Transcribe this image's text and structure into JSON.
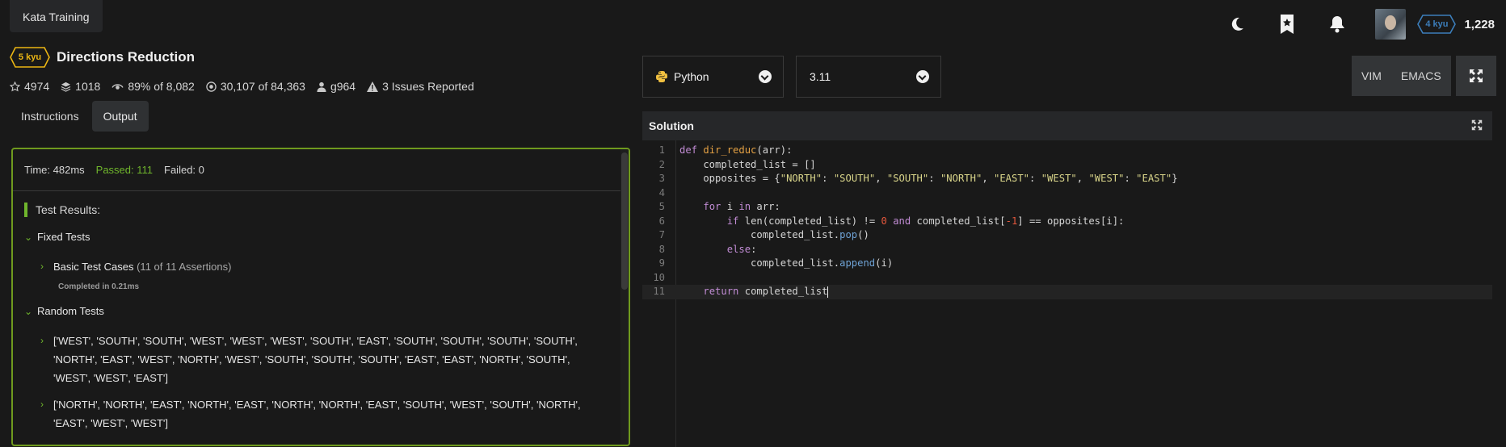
{
  "topbar": {
    "kata_training": "Kata Training",
    "user_rank": "4 kyu",
    "honor": "1,228",
    "icons": [
      "moon-icon",
      "bookmark-star-icon",
      "bell-icon",
      "avatar"
    ],
    "accent_rank_color": "#3c7ebb"
  },
  "kata": {
    "rank": "5 kyu",
    "rank_color": "#ecb613",
    "title": "Directions Reduction",
    "stars": "4974",
    "collections": "1018",
    "satisfaction": "89%",
    "satisfaction_of": "of 8,082",
    "completed": "30,107",
    "completed_of": "of 84,363",
    "author": "g964",
    "issues": "3 Issues Reported"
  },
  "tabs": {
    "instructions": "Instructions",
    "output": "Output"
  },
  "output": {
    "time": "Time: 482ms",
    "passed": "Passed: 111",
    "failed": "Failed: 0",
    "test_results": "Test Results:",
    "fixed_tests": "Fixed Tests",
    "basic_cases": "Basic Test Cases",
    "basic_assertions": "(11 of 11 Assertions)",
    "completed_in": "Completed in 0.21ms",
    "random_tests": "Random Tests",
    "random_case_1": "['WEST', 'SOUTH', 'SOUTH', 'WEST', 'WEST', 'WEST', 'SOUTH', 'EAST', 'SOUTH', 'SOUTH', 'SOUTH', 'SOUTH', 'NORTH', 'EAST', 'WEST', 'NORTH', 'WEST', 'SOUTH', 'SOUTH', 'SOUTH', 'EAST', 'EAST', 'NORTH', 'SOUTH', 'WEST', 'WEST', 'EAST']",
    "random_case_2": "['NORTH', 'NORTH', 'EAST', 'NORTH', 'EAST', 'NORTH', 'NORTH', 'EAST', 'SOUTH', 'WEST', 'SOUTH', 'NORTH', 'EAST', 'WEST', 'WEST']",
    "passed_color": "#6fb52c"
  },
  "editor_bar": {
    "language": "Python",
    "version": "3.11",
    "vim": "VIM",
    "emacs": "EMACS"
  },
  "editor": {
    "title": "Solution",
    "line_numbers": [
      "1",
      "2",
      "3",
      "4",
      "5",
      "6",
      "7",
      "8",
      "9",
      "10",
      "11"
    ]
  }
}
